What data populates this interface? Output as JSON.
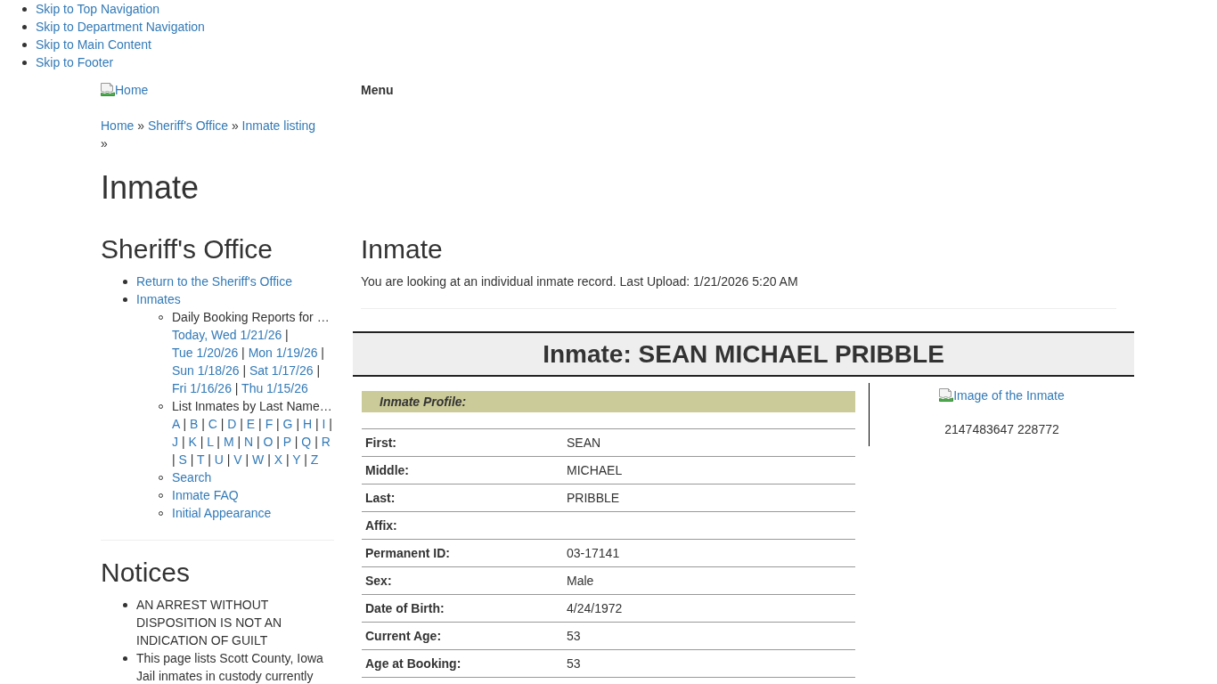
{
  "skip_links": [
    "Skip to Top Navigation",
    "Skip to Department Navigation",
    "Skip to Main Content",
    "Skip to Footer"
  ],
  "header": {
    "logo_alt": "Home",
    "menu": "Menu"
  },
  "breadcrumb": [
    {
      "label": "Home",
      "separator": "»"
    },
    {
      "label": "Sheriff's Office",
      "separator": "»"
    },
    {
      "label": "Inmate listing",
      "separator": "»"
    }
  ],
  "page_title": "Inmate",
  "sidebar": {
    "title": "Sheriff's Office",
    "items": [
      {
        "kind": "link",
        "label": "Return to the Sheriff's Office"
      },
      {
        "kind": "link",
        "label": "Inmates",
        "children": [
          {
            "kind": "group",
            "label": "Daily Booking Reports for …",
            "links": [
              {
                "label": "Today, Wed 1/21/26",
                "separator": "|"
              },
              {
                "label": "Tue 1/20/26",
                "separator": "|"
              },
              {
                "label": "Mon 1/19/26",
                "separator": "|"
              },
              {
                "label": "Sun 1/18/26",
                "separator": "|"
              },
              {
                "label": "Sat 1/17/26",
                "separator": "|"
              },
              {
                "label": "Fri 1/16/26",
                "separator": "|"
              },
              {
                "label": "Thu 1/15/26"
              }
            ]
          },
          {
            "kind": "group",
            "label": "List Inmates by Last Name…",
            "links": [
              {
                "label": "A",
                "separator": "|"
              },
              {
                "label": "B",
                "separator": "|"
              },
              {
                "label": "C",
                "separator": "|"
              },
              {
                "label": "D",
                "separator": "|"
              },
              {
                "label": "E",
                "separator": "|"
              },
              {
                "label": "F",
                "separator": "|"
              },
              {
                "label": "G",
                "separator": "|"
              },
              {
                "label": "H",
                "separator": "|"
              },
              {
                "label": "I",
                "separator": "|"
              },
              {
                "label": "J",
                "separator": "|"
              },
              {
                "label": "K",
                "separator": "|"
              },
              {
                "label": "L",
                "separator": "|"
              },
              {
                "label": "M",
                "separator": "|"
              },
              {
                "label": "N",
                "separator": "|"
              },
              {
                "label": "O",
                "separator": "|"
              },
              {
                "label": "P",
                "separator": "|"
              },
              {
                "label": "Q",
                "separator": "|"
              },
              {
                "label": "R",
                "separator": "|"
              },
              {
                "label": "S",
                "separator": "|"
              },
              {
                "label": "T",
                "separator": "|"
              },
              {
                "label": "U",
                "separator": "|"
              },
              {
                "label": "V",
                "separator": "|"
              },
              {
                "label": "W",
                "separator": "|"
              },
              {
                "label": "X",
                "separator": "|"
              },
              {
                "label": "Y",
                "separator": "|"
              },
              {
                "label": "Z"
              }
            ]
          },
          {
            "kind": "link",
            "label": "Search"
          },
          {
            "kind": "link",
            "label": "Inmate FAQ"
          },
          {
            "kind": "link",
            "label": "Initial Appearance"
          }
        ]
      }
    ]
  },
  "notices": {
    "title": "Notices",
    "items": [
      "AN ARREST WITHOUT DISPOSITION IS NOT AN INDICATION OF GUILT",
      "This page lists Scott County, Iowa Jail inmates in custody currently"
    ]
  },
  "main": {
    "title": "Inmate",
    "intro": "You are looking at an individual inmate record. Last Upload: 1/21/2026 5:20 AM",
    "banner": "Inmate: SEAN MICHAEL PRIBBLE",
    "profile": {
      "heading": "Inmate Profile:",
      "rows": [
        {
          "label": "First:",
          "value": "SEAN"
        },
        {
          "label": "Middle:",
          "value": "MICHAEL"
        },
        {
          "label": "Last:",
          "value": "PRIBBLE"
        },
        {
          "label": "Affix:"
        },
        {
          "label": "Permanent ID:",
          "value": "03-17141"
        },
        {
          "label": "Sex:",
          "value": "Male"
        },
        {
          "label": "Date of Birth:",
          "value": "4/24/1972"
        },
        {
          "label": "Current Age:",
          "value": "53"
        },
        {
          "label": "Age at Booking:",
          "value": "53"
        }
      ]
    },
    "photo": {
      "alt": "Image of the Inmate",
      "caption": "2147483647 228772"
    }
  }
}
